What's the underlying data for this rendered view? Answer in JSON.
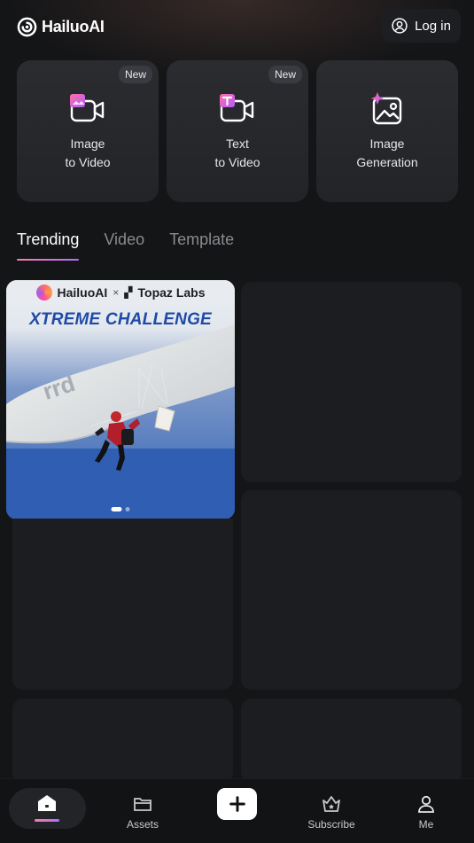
{
  "header": {
    "logo_text": "HailuoAI",
    "login_label": "Log in"
  },
  "features": [
    {
      "label": "Image\nto Video",
      "badge": "New",
      "icon": "image-to-video-icon"
    },
    {
      "label": "Text\nto Video",
      "badge": "New",
      "icon": "text-to-video-icon"
    },
    {
      "label": "Image\nGeneration",
      "badge": "",
      "icon": "image-generation-icon"
    }
  ],
  "tabs": [
    {
      "label": "Trending",
      "active": true
    },
    {
      "label": "Video",
      "active": false
    },
    {
      "label": "Template",
      "active": false
    }
  ],
  "banner": {
    "brand_left": "HailuoAI",
    "separator": "×",
    "brand_right": "Topaz Labs",
    "title": "XTREME CHALLENGE"
  },
  "bottom_nav": [
    {
      "label": "",
      "icon": "home-icon",
      "active": true
    },
    {
      "label": "Assets",
      "icon": "folder-icon"
    },
    {
      "label": "",
      "icon": "plus-icon"
    },
    {
      "label": "Subscribe",
      "icon": "crown-icon"
    },
    {
      "label": "Me",
      "icon": "user-icon"
    }
  ],
  "colors": {
    "background": "#141517",
    "accent_gradient_start": "#ff7aa8",
    "accent_gradient_end": "#b06cff",
    "banner_title": "#1f4aa6"
  }
}
